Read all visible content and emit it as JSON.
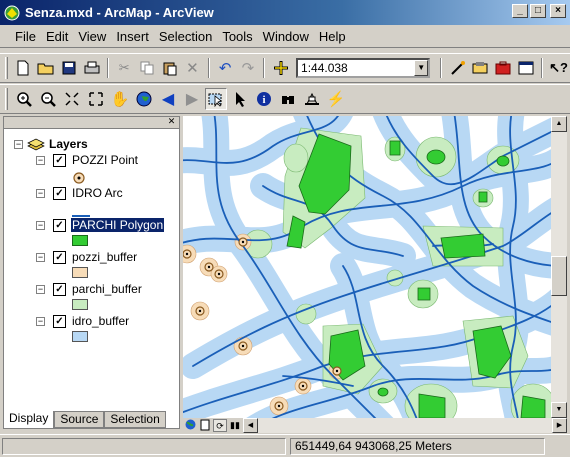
{
  "window": {
    "title": "Senza.mxd - ArcMap - ArcView"
  },
  "menu": [
    "File",
    "Edit",
    "View",
    "Insert",
    "Selection",
    "Tools",
    "Window",
    "Help"
  ],
  "toolbar": {
    "scale_value": "1:44.038"
  },
  "toc": {
    "root_label": "Layers",
    "layers": [
      {
        "name": "POZZI Point",
        "checked": true,
        "legend": "point-symbol",
        "selected": false
      },
      {
        "name": "IDRO Arc",
        "checked": true,
        "legend": "line-symbol",
        "selected": false
      },
      {
        "name": "PARCHI Polygon",
        "checked": true,
        "legend": "green-fill",
        "selected": true
      },
      {
        "name": "pozzi_buffer",
        "checked": true,
        "legend": "peach-fill",
        "selected": false
      },
      {
        "name": "parchi_buffer",
        "checked": true,
        "legend": "light-green-fill",
        "selected": false
      },
      {
        "name": "idro_buffer",
        "checked": true,
        "legend": "light-blue-fill",
        "selected": false
      }
    ],
    "tabs": [
      "Display",
      "Source",
      "Selection"
    ]
  },
  "status": {
    "coordinates": "651449,64  943068,25 Meters"
  },
  "colors": {
    "titlebar": "#0a246a",
    "parchi": "#33cc33",
    "parchi_buffer": "#c8ecc0",
    "idro_buffer": "#b8d8f4",
    "idro_line": "#1a5fb8",
    "pozzi_buffer": "#f7dcb8"
  }
}
